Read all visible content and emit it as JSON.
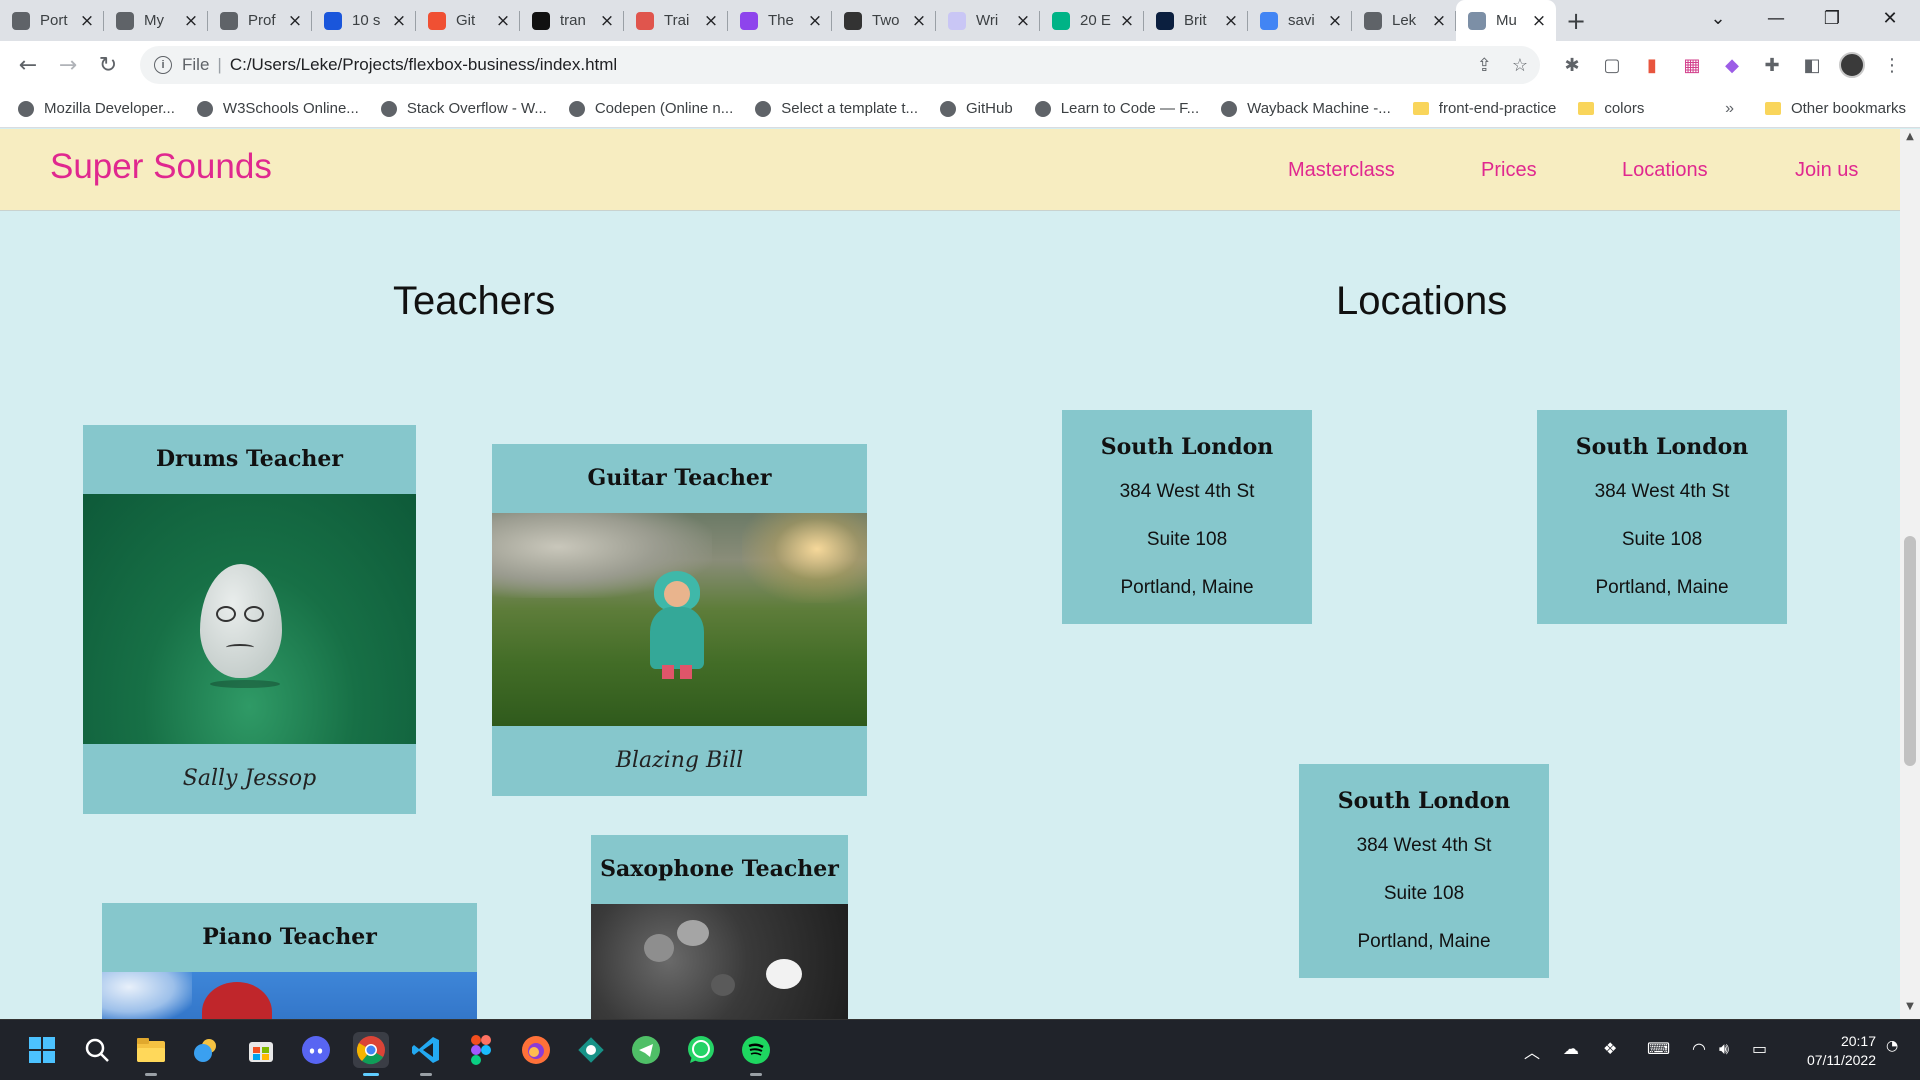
{
  "browser": {
    "tabs": [
      {
        "title": "Port",
        "icon": "doc-icon",
        "color": "#5f6368"
      },
      {
        "title": "My",
        "icon": "globe-icon",
        "color": "#5f6368"
      },
      {
        "title": "Prof",
        "icon": "swirl-icon",
        "color": "#5f6368"
      },
      {
        "title": "10 s",
        "icon": "w-icon",
        "color": "#1a56db"
      },
      {
        "title": "Git",
        "icon": "git-icon",
        "color": "#f05033"
      },
      {
        "title": "tran",
        "icon": "m-icon",
        "color": "#111111"
      },
      {
        "title": "Trai",
        "icon": "training-icon",
        "color": "#e0554d"
      },
      {
        "title": "The",
        "icon": "u-icon",
        "color": "#8e44ec"
      },
      {
        "title": "Two",
        "icon": "c-icon",
        "color": "#333333"
      },
      {
        "title": "Wri",
        "icon": "write-icon",
        "color": "#c9c6f5"
      },
      {
        "title": "20 E",
        "icon": "b-icon",
        "color": "#00b386"
      },
      {
        "title": "Brit",
        "icon": "britannica-icon",
        "color": "#0b1f3f"
      },
      {
        "title": "savi",
        "icon": "google-icon",
        "color": "#4285f4"
      },
      {
        "title": "Lek",
        "icon": "globe-icon",
        "color": "#5f6368"
      },
      {
        "title": "Mu",
        "icon": "building-icon",
        "color": "#7c8fa6",
        "active": true
      }
    ],
    "address": {
      "scheme_label": "File",
      "url": "C:/Users/Leke/Projects/flexbox-business/index.html"
    },
    "bookmarks": [
      {
        "label": "Mozilla Developer...",
        "icon": "globe-icon"
      },
      {
        "label": "W3Schools Online...",
        "icon": "globe-icon"
      },
      {
        "label": "Stack Overflow - W...",
        "icon": "globe-icon"
      },
      {
        "label": "Codepen (Online n...",
        "icon": "star-icon"
      },
      {
        "label": "Select a template t...",
        "icon": "chevron-icon"
      },
      {
        "label": "GitHub",
        "icon": "github-icon"
      },
      {
        "label": "Learn to Code — F...",
        "icon": "globe-icon"
      },
      {
        "label": "Wayback Machine -...",
        "icon": "wayback-icon"
      },
      {
        "label": "front-end-practice",
        "icon": "folder-icon"
      },
      {
        "label": "colors",
        "icon": "folder-icon"
      }
    ],
    "bookmarks_more": "»",
    "other_bookmarks": "Other bookmarks"
  },
  "site": {
    "brand": "Super Sounds",
    "nav": [
      "Masterclass",
      "Prices",
      "Locations",
      "Join us"
    ],
    "teachers_heading": "Teachers",
    "locations_heading": "Locations",
    "teachers": [
      {
        "title": "Drums Teacher",
        "name": "Sally Jessop"
      },
      {
        "title": "Guitar Teacher",
        "name": "Blazing Bill"
      },
      {
        "title": "Saxophone Teacher"
      },
      {
        "title": "Piano Teacher"
      }
    ],
    "locations": [
      {
        "title": "South London",
        "line1": "384 West 4th St",
        "line2": "Suite 108",
        "line3": "Portland, Maine"
      },
      {
        "title": "South London",
        "line1": "384 West 4th St",
        "line2": "Suite 108",
        "line3": "Portland, Maine"
      },
      {
        "title": "South London",
        "line1": "384 West 4th St",
        "line2": "Suite 108",
        "line3": "Portland, Maine"
      }
    ],
    "colors": {
      "accent": "#e0288f",
      "header_bg": "#f7edc1",
      "page_bg": "#d5eef1",
      "card_bg": "#86c7cc"
    }
  },
  "taskbar": {
    "apps": [
      "windows-start-icon",
      "search-icon",
      "file-explorer-icon",
      "weather-icon",
      "store-icon",
      "discord-icon",
      "chrome-icon",
      "vscode-icon",
      "figma-icon",
      "firefox-icon",
      "gitkraken-icon",
      "telegram-icon",
      "whatsapp-icon",
      "spotify-icon"
    ],
    "time": "20:17",
    "date": "07/11/2022"
  }
}
